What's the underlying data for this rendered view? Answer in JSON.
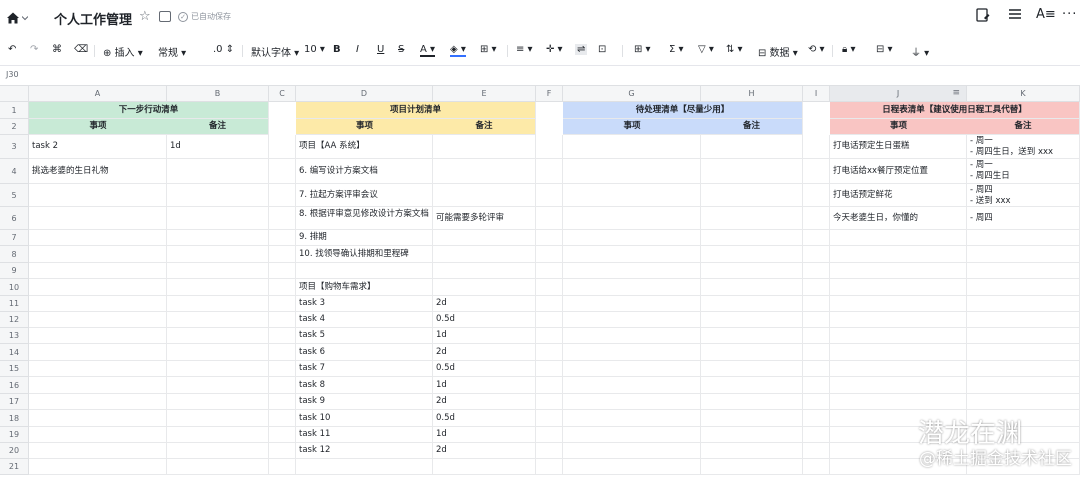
{
  "topbar": {
    "title": "个人工作管理",
    "saved_status": "已自动保存"
  },
  "toolbar": {
    "insert_label": "插入",
    "format_label": "常规",
    "decimal_label": ".0",
    "font_label": "默认字体",
    "size_label": "10",
    "data_label": "数据"
  },
  "namebox": {
    "cell_ref": "J30"
  },
  "columns": [
    "A",
    "B",
    "C",
    "D",
    "E",
    "F",
    "G",
    "H",
    "I",
    "J",
    "K"
  ],
  "rows": [
    "1",
    "2",
    "3",
    "4",
    "5",
    "6",
    "7",
    "8",
    "9",
    "10",
    "11",
    "12",
    "13",
    "14",
    "15",
    "16",
    "17",
    "18",
    "19",
    "20",
    "21"
  ],
  "sections": {
    "next_actions": {
      "title": "下一步行动清单",
      "col1": "事项",
      "col2": "备注",
      "color": "#c8ead6"
    },
    "project_plan": {
      "title": "项目计划清单",
      "col1": "事项",
      "col2": "备注",
      "color": "#fdeaa8"
    },
    "pending": {
      "title": "待处理清单【尽量少用】",
      "col1": "事项",
      "col2": "备注",
      "color": "#c9dbfa"
    },
    "schedule": {
      "title": "日程表清单【建议使用日程工具代替】",
      "col1": "事项",
      "col2": "备注",
      "color": "#f9c5c3"
    }
  },
  "cells": {
    "A3": "task 2",
    "B3": "1d",
    "A4": "挑选老婆的生日礼物",
    "D3": "项目【AA 系统】",
    "D4": "6. 编写设计方案文档",
    "D5": "7. 拉起方案评审会议",
    "D6": "8. 根据评审意见修改设计方案文档",
    "E6": "可能需要多轮评审",
    "D7": "9. 排期",
    "D8": "10. 找领导确认排期和里程碑",
    "D10": "项目【购物车需求】",
    "D11": "task 3",
    "E11": "2d",
    "D12": "task 4",
    "E12": "0.5d",
    "D13": "task 5",
    "E13": "1d",
    "D14": "task 6",
    "E14": "2d",
    "D15": "task 7",
    "E15": "0.5d",
    "D16": "task 8",
    "E16": "1d",
    "D17": "task 9",
    "E17": "2d",
    "D18": "task 10",
    "E18": "0.5d",
    "D19": "task 11",
    "E19": "1d",
    "D20": "task 12",
    "E20": "2d",
    "J3": "打电话预定生日蛋糕",
    "K3": "- 周一\n- 周四生日，送到 xxx",
    "J4": "打电话给xx餐厅预定位置",
    "K4": "- 周一\n- 周四生日",
    "J5": "打电话预定鲜花",
    "K5": "- 周四\n- 送到 xxx",
    "J6": "今天老婆生日，你懂的",
    "K6": "- 周四"
  },
  "watermark": {
    "line1": "潜龙在渊",
    "line2": "@稀土掘金技术社区"
  }
}
